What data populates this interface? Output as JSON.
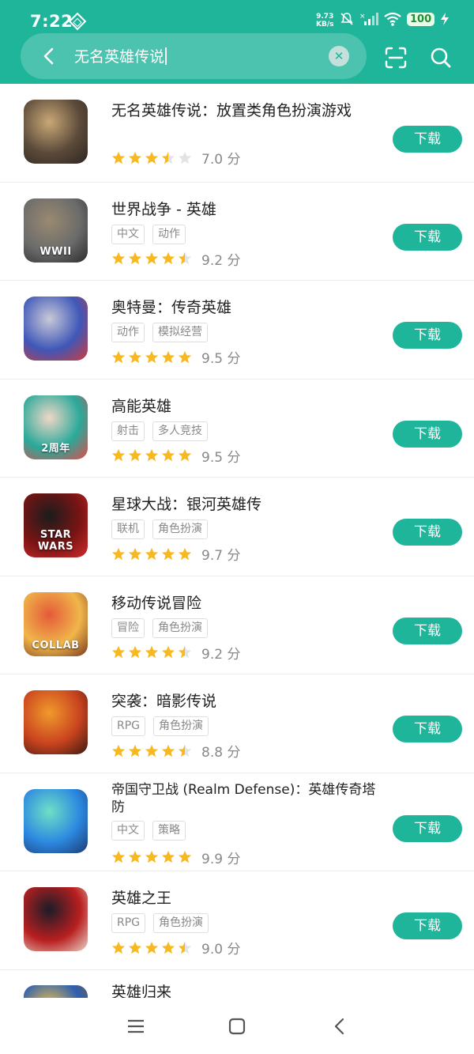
{
  "status": {
    "time": "7:22",
    "net_speed": "9.73",
    "net_unit": "KB/s",
    "battery": "100"
  },
  "search": {
    "query": "无名英雄传说"
  },
  "common": {
    "download_label": "下载",
    "score_suffix": "分"
  },
  "apps": [
    {
      "name": "无名英雄传说：放置类角色扮演游戏",
      "tags": [],
      "rating": 3.5,
      "score": "7.0",
      "icon_colors": [
        "#5b4a3a",
        "#c9a877",
        "#2e2520"
      ],
      "icon_text": ""
    },
    {
      "name": "世界战争 - 英雄",
      "tags": [
        "中文",
        "动作"
      ],
      "rating": 4.5,
      "score": "9.2",
      "icon_colors": [
        "#6b6b6b",
        "#9a8a70",
        "#2b2b2b"
      ],
      "icon_text": "WWII"
    },
    {
      "name": "奥特曼：传奇英雄",
      "tags": [
        "动作",
        "模拟经营"
      ],
      "rating": 5,
      "score": "9.5",
      "icon_colors": [
        "#3f57b8",
        "#c9c9d8",
        "#d13a3a"
      ],
      "icon_text": ""
    },
    {
      "name": "高能英雄",
      "tags": [
        "射击",
        "多人竞技"
      ],
      "rating": 5,
      "score": "9.5",
      "icon_colors": [
        "#2aa99a",
        "#f0d7c7",
        "#e24a4a"
      ],
      "icon_text": "2周年"
    },
    {
      "name": "星球大战：银河英雄传",
      "tags": [
        "联机",
        "角色扮演"
      ],
      "rating": 5,
      "score": "9.7",
      "icon_colors": [
        "#7a1414",
        "#1c1c1c",
        "#d02b2b"
      ],
      "icon_text": "STAR WARS"
    },
    {
      "name": "移动传说冒险",
      "tags": [
        "冒险",
        "角色扮演"
      ],
      "rating": 4.5,
      "score": "9.2",
      "icon_colors": [
        "#f0b64a",
        "#e45a3a",
        "#7a3a20"
      ],
      "icon_text": "COLLAB"
    },
    {
      "name": "突袭：暗影传说",
      "tags": [
        "RPG",
        "角色扮演"
      ],
      "rating": 4.5,
      "score": "8.8",
      "icon_colors": [
        "#c9431f",
        "#f19a2c",
        "#3a1a10"
      ],
      "icon_text": ""
    },
    {
      "name": "帝国守卫战 (Realm Defense)：英雄传奇塔防",
      "tags": [
        "中文",
        "策略"
      ],
      "rating": 5,
      "score": "9.9",
      "icon_colors": [
        "#2c88e0",
        "#6fe0c6",
        "#1b3a72"
      ],
      "icon_text": ""
    },
    {
      "name": "英雄之王",
      "tags": [
        "RPG",
        "角色扮演"
      ],
      "rating": 4.5,
      "score": "9.0",
      "icon_colors": [
        "#b81f1f",
        "#1c1c28",
        "#e9d3c7"
      ],
      "icon_text": ""
    },
    {
      "name": "英雄归来",
      "tags": [],
      "rating": 0,
      "score": "",
      "icon_colors": [
        "#2d5fb0",
        "#f2c14a",
        "#8a5a20"
      ],
      "icon_text": ""
    }
  ],
  "colors": {
    "brand": "#1fb59b",
    "star_on": "#f8b81f",
    "star_off": "#e3e3e3"
  }
}
